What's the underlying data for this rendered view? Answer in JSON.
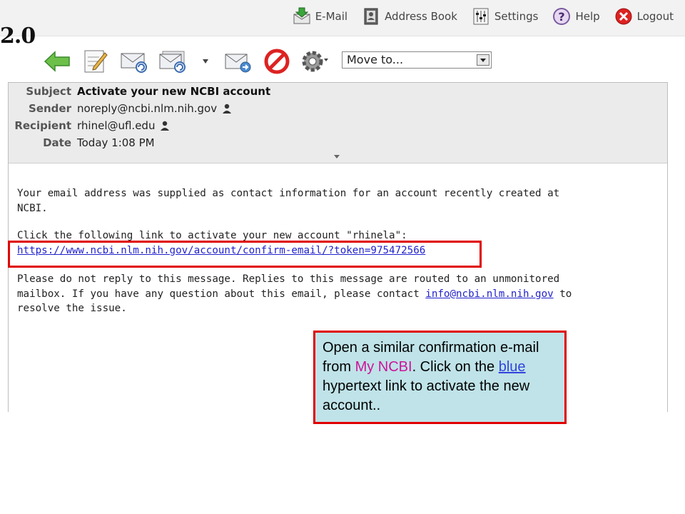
{
  "brand": "2.0",
  "topnav": {
    "email": "E-Mail",
    "address_book": "Address Book",
    "settings": "Settings",
    "help": "Help",
    "logout": "Logout"
  },
  "toolbar": {
    "move_to": "Move to..."
  },
  "headers": {
    "subject_label": "Subject",
    "subject": "Activate your new NCBI account",
    "sender_label": "Sender",
    "sender": "noreply@ncbi.nlm.nih.gov",
    "recipient_label": "Recipient",
    "recipient": "rhinel@ufl.edu",
    "date_label": "Date",
    "date": "Today 1:08 PM"
  },
  "body": {
    "p1_line1": "Your email address was supplied as contact information for an account recently created at",
    "p1_line2": "NCBI.",
    "p2_line1": "Click the following link to activate your new account \"rhinela\":",
    "activation_link": "https://www.ncbi.nlm.nih.gov/account/confirm-email/?token=975472566",
    "p3_line1": "Please do not reply to this message. Replies to this message are routed to an unmonitored",
    "p3_line2_a": "mailbox. If you have any question about this email, please contact ",
    "contact_link": "info@ncbi.nlm.nih.gov",
    "p3_line2_b": " to",
    "p3_line3": "resolve the issue."
  },
  "callout": {
    "t1": "Open a similar confirmation e-mail from ",
    "t2": "My NCBI",
    "t3": ".  Click on the ",
    "t4": "blue",
    "t5": " hypertext link to activate the new account.."
  },
  "colors": {
    "highlight_border": "#e00000",
    "callout_bg": "#bfe3e8",
    "link_blue": "#2222cc",
    "magenta": "#cc1599"
  }
}
